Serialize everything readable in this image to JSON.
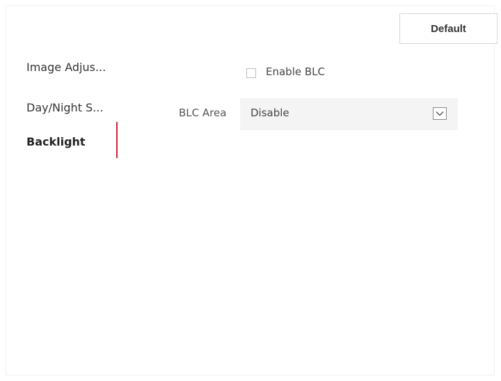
{
  "toolbar": {
    "default_label": "Default"
  },
  "sidebar": {
    "items": [
      {
        "label": "Image Adjus...",
        "active": false
      },
      {
        "label": "Day/Night S...",
        "active": false
      },
      {
        "label": "Backlight",
        "active": true
      }
    ],
    "active_color": "#e5193b"
  },
  "form": {
    "enable_blc": {
      "label": "Enable BLC",
      "checked": false
    },
    "blc_area": {
      "label": "BLC Area",
      "value": "Disable",
      "icon": "chevron-down-icon"
    }
  }
}
